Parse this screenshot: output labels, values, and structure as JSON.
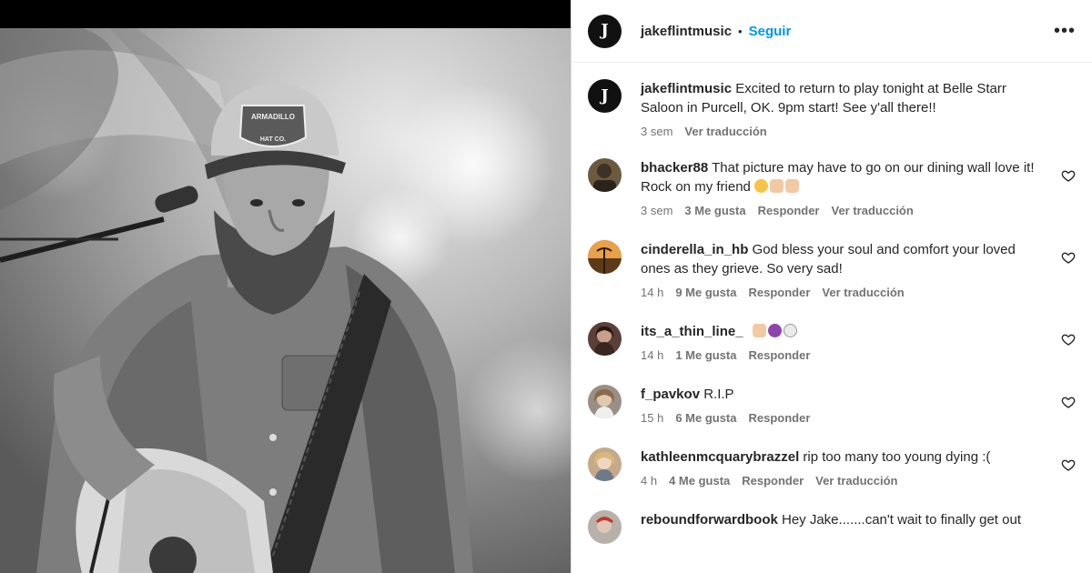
{
  "header": {
    "username": "jakeflintmusic",
    "dot": "•",
    "follow_label": "Seguir",
    "more_label": "•••"
  },
  "caption": {
    "username": "jakeflintmusic",
    "text": "Excited to return to play tonight at Belle Starr Saloon in Purcell, OK. 9pm start! See y'all there!!",
    "time": "3 sem",
    "translate": "Ver traducción"
  },
  "comments": [
    {
      "username": "bhacker88",
      "text": "That picture may have to go on our dining wall love it! Rock on my friend",
      "emojis": [
        "laughing-emoji",
        "flexed-arm-emoji",
        "thumbs-up-emoji"
      ],
      "time": "3 sem",
      "likes": "3 Me gusta",
      "reply": "Responder",
      "translate": "Ver traducción",
      "avatar_color": "#6b5a3e"
    },
    {
      "username": "cinderella_in_hb",
      "text": "God bless your soul and comfort your loved ones as they grieve. So very sad!",
      "time": "14 h",
      "likes": "9 Me gusta",
      "reply": "Responder",
      "translate": "Ver traducción",
      "avatar_color": "#c97a2a"
    },
    {
      "username": "its_a_thin_line_",
      "text": "",
      "emojis": [
        "praying-hands-emoji",
        "purple-heart-emoji",
        "dove-emoji"
      ],
      "time": "14 h",
      "likes": "1 Me gusta",
      "reply": "Responder",
      "avatar_color": "#5a4038"
    },
    {
      "username": "f_pavkov",
      "text": "R.I.P",
      "time": "15 h",
      "likes": "6 Me gusta",
      "reply": "Responder",
      "avatar_color": "#9a8f86"
    },
    {
      "username": "kathleenmcquarybrazzel",
      "text": "rip too many too young dying :(",
      "time": "4 h",
      "likes": "4 Me gusta",
      "reply": "Responder",
      "translate": "Ver traducción",
      "avatar_color": "#c4a98a"
    },
    {
      "username": "reboundforwardbook",
      "text": "Hey Jake.......can't wait to finally get out",
      "avatar_color": "#b8b0aa"
    }
  ],
  "colors": {
    "follow_blue": "#0095f6",
    "text": "#262626",
    "meta_gray": "#737373"
  }
}
